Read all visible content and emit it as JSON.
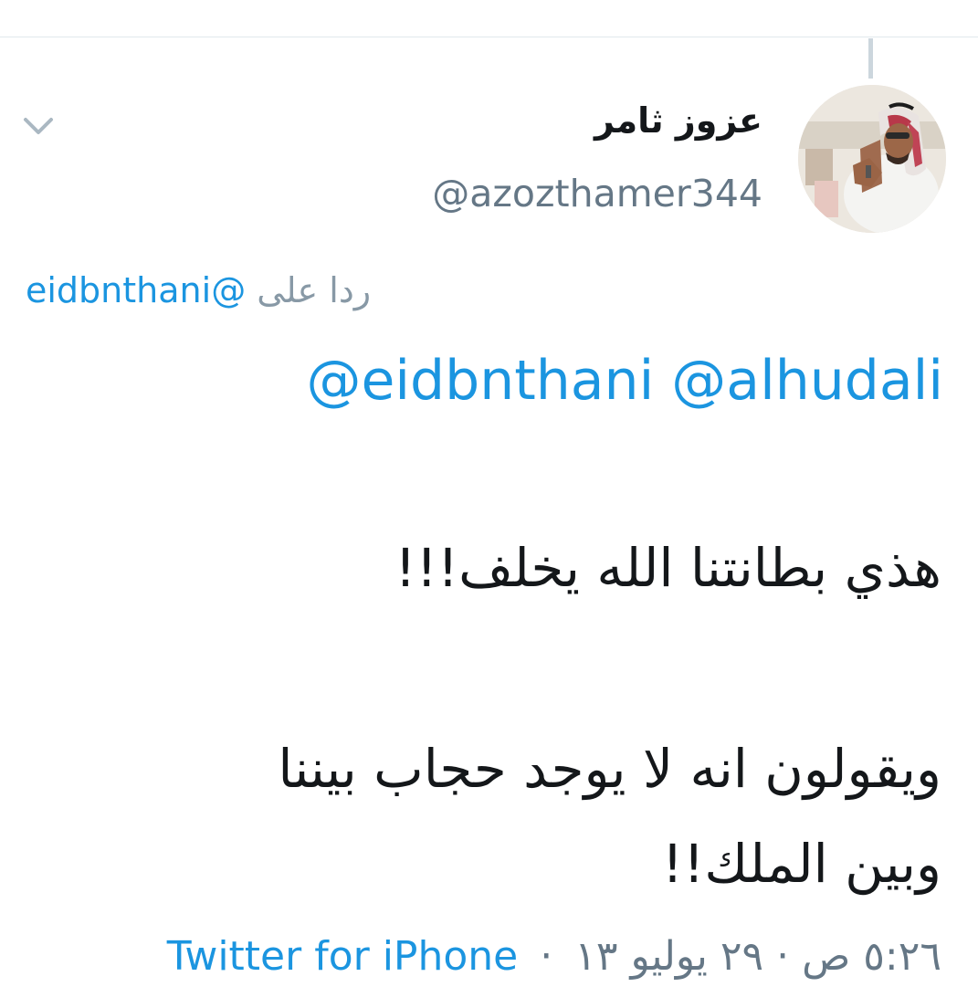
{
  "tweet": {
    "author": {
      "display_name": "عزوز ثامر",
      "handle": "@azozthamer344",
      "avatar_icon": "profile-photo"
    },
    "reply_to": {
      "prefix": "ردا على",
      "mention": "@eidbnthani"
    },
    "mentions_line": "@eidbnthani @alhudali",
    "text_lines": [
      "هذي بطانتنا الله يخلف!!!",
      "ويقولون انه لا يوجد حجاب بيننا",
      "وبين الملك!!"
    ],
    "timestamp": "٥:٢٦ ص · ٢٩ يوليو ١٣",
    "separator": "·",
    "source": "Twitter for iPhone",
    "menu_icon": "chevron-down-icon"
  },
  "colors": {
    "link": "#1b95e0",
    "secondary_text": "#657786",
    "primary_text": "#14171a",
    "divider": "#e1e8ed",
    "thread_line": "#ccd6dd"
  }
}
